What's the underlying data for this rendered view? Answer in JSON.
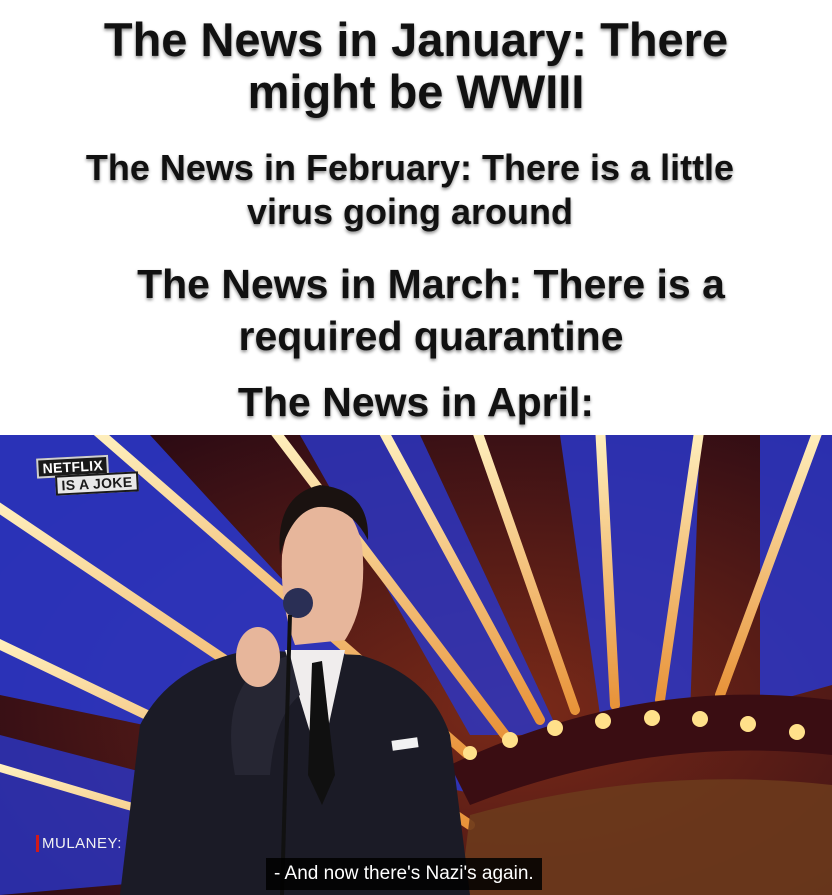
{
  "caption": {
    "lines": [
      {
        "a": "The News in January: There",
        "b": "might be WWIII"
      },
      {
        "a": "The News in February: There is a little",
        "b": "virus going around"
      },
      {
        "a": "The News in March: There is a",
        "b": "required quarantine"
      },
      {
        "a": "The News in April:",
        "b": ""
      }
    ]
  },
  "scene": {
    "badge_line1": "NETFLIX",
    "badge_line2": "IS A JOKE",
    "speaker_label": "MULANEY:",
    "subtitle": "- And now there's Nazi's again."
  },
  "colors": {
    "caption_text": "#111111",
    "stage_blue": "#2a36c9",
    "stage_maroon": "#5a1222",
    "stage_gold": "#f4c46a",
    "speaker_accent": "#d11a1a"
  }
}
